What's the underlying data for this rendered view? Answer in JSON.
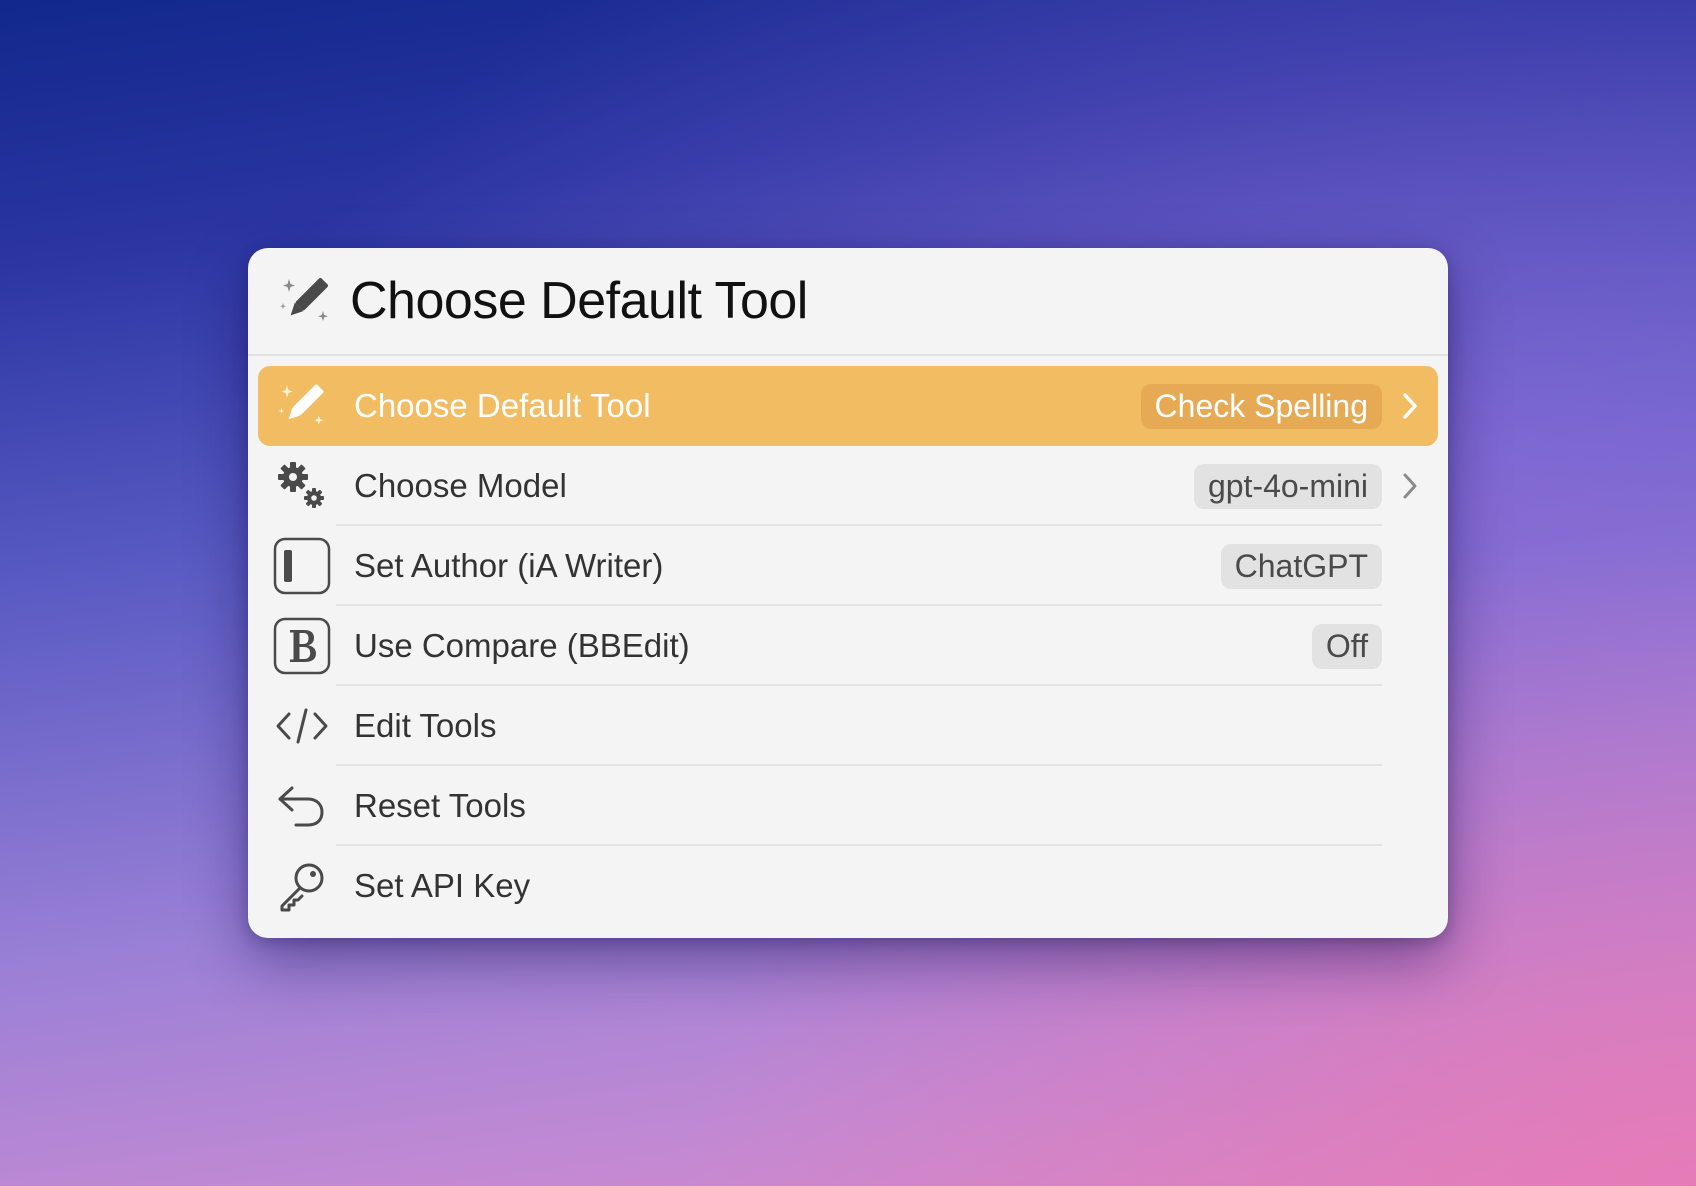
{
  "header": {
    "title": "Choose Default Tool",
    "icon": "magic-pencil-icon"
  },
  "accent_color": "#f2bc63",
  "items": [
    {
      "label": "Choose Default Tool",
      "value": "Check Spelling",
      "icon": "magic-pencil-icon",
      "has_submenu": true,
      "selected": true
    },
    {
      "label": "Choose Model",
      "value": "gpt-4o-mini",
      "icon": "gears-icon",
      "has_submenu": true,
      "selected": false
    },
    {
      "label": "Set Author (iA Writer)",
      "value": "ChatGPT",
      "icon": "ia-writer-icon",
      "has_submenu": false,
      "selected": false
    },
    {
      "label": "Use Compare (BBEdit)",
      "value": "Off",
      "icon": "bbedit-icon",
      "has_submenu": false,
      "selected": false
    },
    {
      "label": "Edit Tools",
      "icon": "code-brackets-icon",
      "has_submenu": false,
      "selected": false
    },
    {
      "label": "Reset Tools",
      "icon": "undo-arrow-icon",
      "has_submenu": false,
      "selected": false
    },
    {
      "label": "Set API Key",
      "icon": "key-icon",
      "has_submenu": false,
      "selected": false
    }
  ]
}
